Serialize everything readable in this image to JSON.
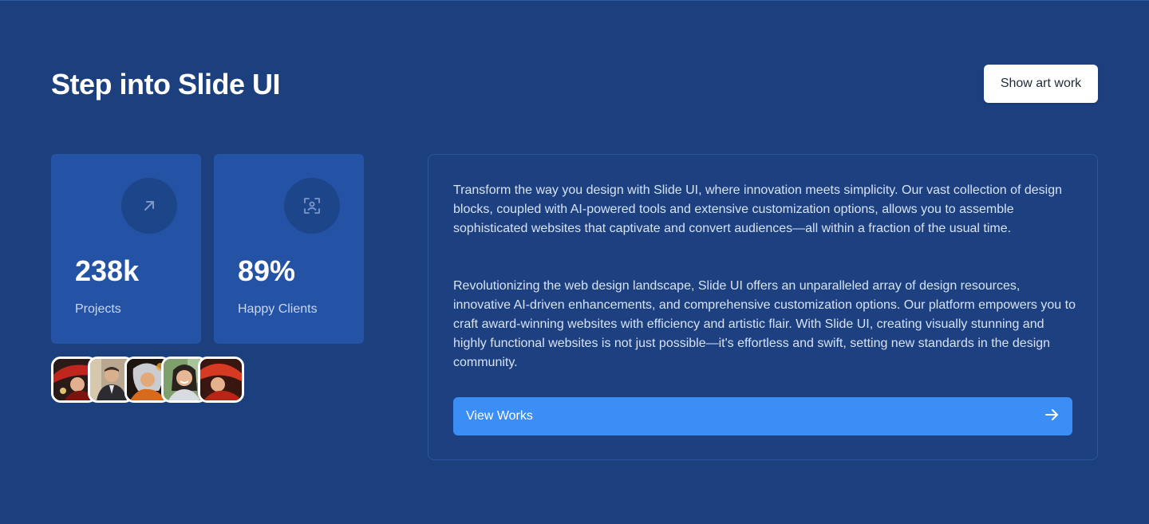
{
  "header": {
    "title": "Step into Slide UI",
    "art_button_label": "Show art work"
  },
  "stats": [
    {
      "value": "238k",
      "label": "Projects",
      "icon": "arrow-up-right-icon"
    },
    {
      "value": "89%",
      "label": "Happy Clients",
      "icon": "face-scan-icon"
    }
  ],
  "avatars": [
    {
      "icon": "avatar-red-hat"
    },
    {
      "icon": "avatar-man-suit"
    },
    {
      "icon": "avatar-woman-orange"
    },
    {
      "icon": "avatar-woman-smiling"
    },
    {
      "icon": "avatar-red-hat"
    }
  ],
  "info": {
    "paragraph_1": "Transform the way you design with Slide UI, where innovation meets simplicity. Our vast collection of design blocks, coupled with AI-powered tools and extensive customization options, allows you to assemble sophisticated websites that captivate and convert audiences—all within a fraction of the usual time.",
    "paragraph_2": "Revolutionizing the web design landscape, Slide UI offers an unparalleled array of design resources, innovative AI-driven enhancements, and comprehensive customization options. Our platform empowers you to craft award-winning websites with efficiency and artistic flair. With Slide UI, creating visually stunning and highly functional websites is not just possible—it's effortless and swift, setting new standards in the design community.",
    "cta_label": "View Works",
    "cta_icon": "arrow-right-icon"
  },
  "colors": {
    "background": "#1c3f7e",
    "card": "#2453a5",
    "accent": "#3b8ef5"
  }
}
